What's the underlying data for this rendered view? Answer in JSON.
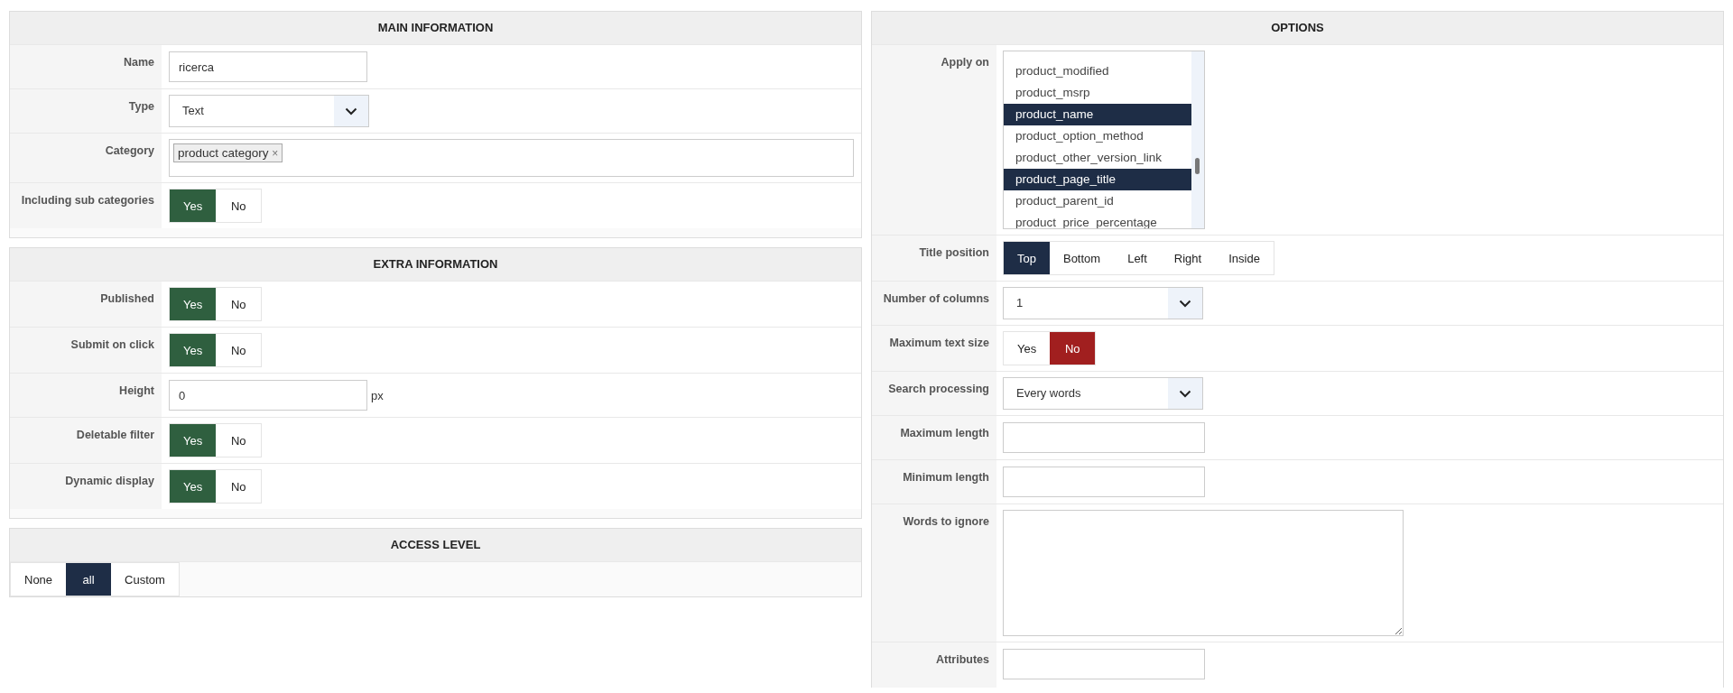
{
  "left_column": [
    {
      "title": "MAIN INFORMATION",
      "fields": [
        {
          "kind": "text",
          "label": "Name",
          "value": "ricerca"
        },
        {
          "kind": "select",
          "label": "Type",
          "value": "Text"
        },
        {
          "kind": "tags",
          "label": "Category",
          "tags": [
            {
              "text": "product category",
              "remove": "×"
            }
          ]
        },
        {
          "kind": "toggle",
          "label": "Including sub categories",
          "options": [
            {
              "text": "Yes",
              "selected": true
            },
            {
              "text": "No",
              "selected": false
            }
          ]
        }
      ]
    },
    {
      "title": "EXTRA INFORMATION",
      "fields": [
        {
          "kind": "toggle",
          "label": "Published",
          "options": [
            {
              "text": "Yes",
              "selected": true
            },
            {
              "text": "No",
              "selected": false
            }
          ]
        },
        {
          "kind": "toggle",
          "label": "Submit on click",
          "options": [
            {
              "text": "Yes",
              "selected": true
            },
            {
              "text": "No",
              "selected": false
            }
          ]
        },
        {
          "kind": "text",
          "label": "Height",
          "value": "0",
          "suffix": "px"
        },
        {
          "kind": "toggle",
          "label": "Deletable filter",
          "options": [
            {
              "text": "Yes",
              "selected": true
            },
            {
              "text": "No",
              "selected": false
            }
          ]
        },
        {
          "kind": "toggle",
          "label": "Dynamic display",
          "options": [
            {
              "text": "Yes",
              "selected": true
            },
            {
              "text": "No",
              "selected": false
            }
          ]
        }
      ]
    },
    {
      "title": "ACCESS LEVEL",
      "fields": [
        {
          "kind": "segmented",
          "options": [
            {
              "text": "None",
              "selected": false
            },
            {
              "text": "all",
              "selected": true
            },
            {
              "text": "Custom",
              "selected": false
            }
          ]
        }
      ]
    }
  ],
  "right_column": [
    {
      "title": "OPTIONS",
      "fields": [
        {
          "kind": "listbox",
          "label": "Apply on",
          "items": [
            {
              "text": "product_modified",
              "selected": false
            },
            {
              "text": "product_msrp",
              "selected": false
            },
            {
              "text": "product_name",
              "selected": true
            },
            {
              "text": "product_option_method",
              "selected": false
            },
            {
              "text": "product_other_version_link",
              "selected": false
            },
            {
              "text": "product_page_title",
              "selected": true
            },
            {
              "text": "product_parent_id",
              "selected": false
            },
            {
              "text": "product_price_percentage",
              "selected": false
            }
          ]
        },
        {
          "kind": "segmented",
          "label": "Title position",
          "options": [
            {
              "text": "Top",
              "selected": true
            },
            {
              "text": "Bottom",
              "selected": false
            },
            {
              "text": "Left",
              "selected": false
            },
            {
              "text": "Right",
              "selected": false
            },
            {
              "text": "Inside",
              "selected": false
            }
          ]
        },
        {
          "kind": "select",
          "label": "Number of columns",
          "value": "1"
        },
        {
          "kind": "toggle",
          "label": "Maximum text size",
          "options": [
            {
              "text": "Yes",
              "selected": false
            },
            {
              "text": "No",
              "selected": true
            }
          ]
        },
        {
          "kind": "select",
          "label": "Search processing",
          "value": "Every words"
        },
        {
          "kind": "text",
          "label": "Maximum length"
        },
        {
          "kind": "text",
          "label": "Minimum length"
        },
        {
          "kind": "textarea",
          "label": "Words to ignore"
        },
        {
          "kind": "text",
          "label": "Attributes"
        }
      ]
    }
  ]
}
